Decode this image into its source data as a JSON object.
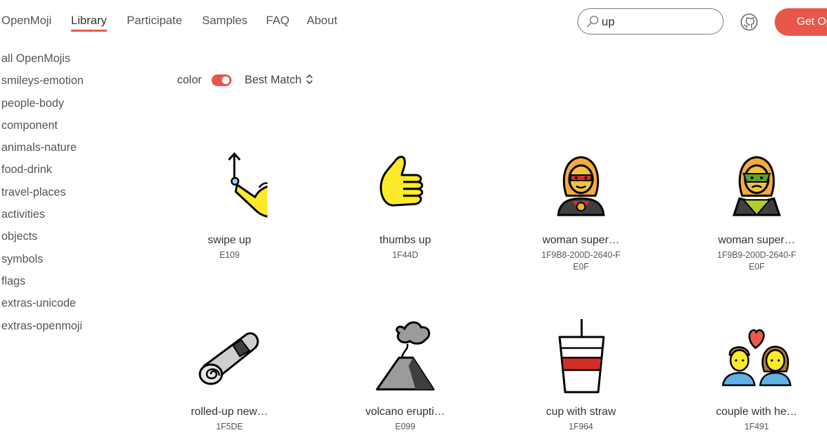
{
  "nav": {
    "brand": "OpenMoji",
    "links": [
      "Library",
      "Participate",
      "Samples",
      "FAQ",
      "About"
    ],
    "active": "Library"
  },
  "search": {
    "value": "up"
  },
  "github_icon": "github-icon",
  "get_button": "Get Op",
  "sidebar": {
    "items": [
      "all OpenMojis",
      "smileys-emotion",
      "people-body",
      "component",
      "animals-nature",
      "food-drink",
      "travel-places",
      "activities",
      "objects",
      "symbols",
      "flags",
      "extras-unicode",
      "extras-openmoji"
    ]
  },
  "filters": {
    "color_label": "color",
    "color_on": true,
    "sort_label": "Best Match"
  },
  "emojis": [
    {
      "name": "swipe up",
      "code": "E109"
    },
    {
      "name": "thumbs up",
      "code": "1F44D"
    },
    {
      "name": "woman super…",
      "code": "1F9B8-200D-2640-FE0F"
    },
    {
      "name": "woman super…",
      "code": "1F9B9-200D-2640-FE0F"
    },
    {
      "name": "rolled-up new…",
      "code": "1F5DE"
    },
    {
      "name": "volcano erupti…",
      "code": "E099"
    },
    {
      "name": "cup with straw",
      "code": "1F964"
    },
    {
      "name": "couple with he…",
      "code": "1F491"
    }
  ],
  "colors": {
    "accent": "#e8574a",
    "yellow": "#fcea2b",
    "skin": "#f1c33c"
  }
}
